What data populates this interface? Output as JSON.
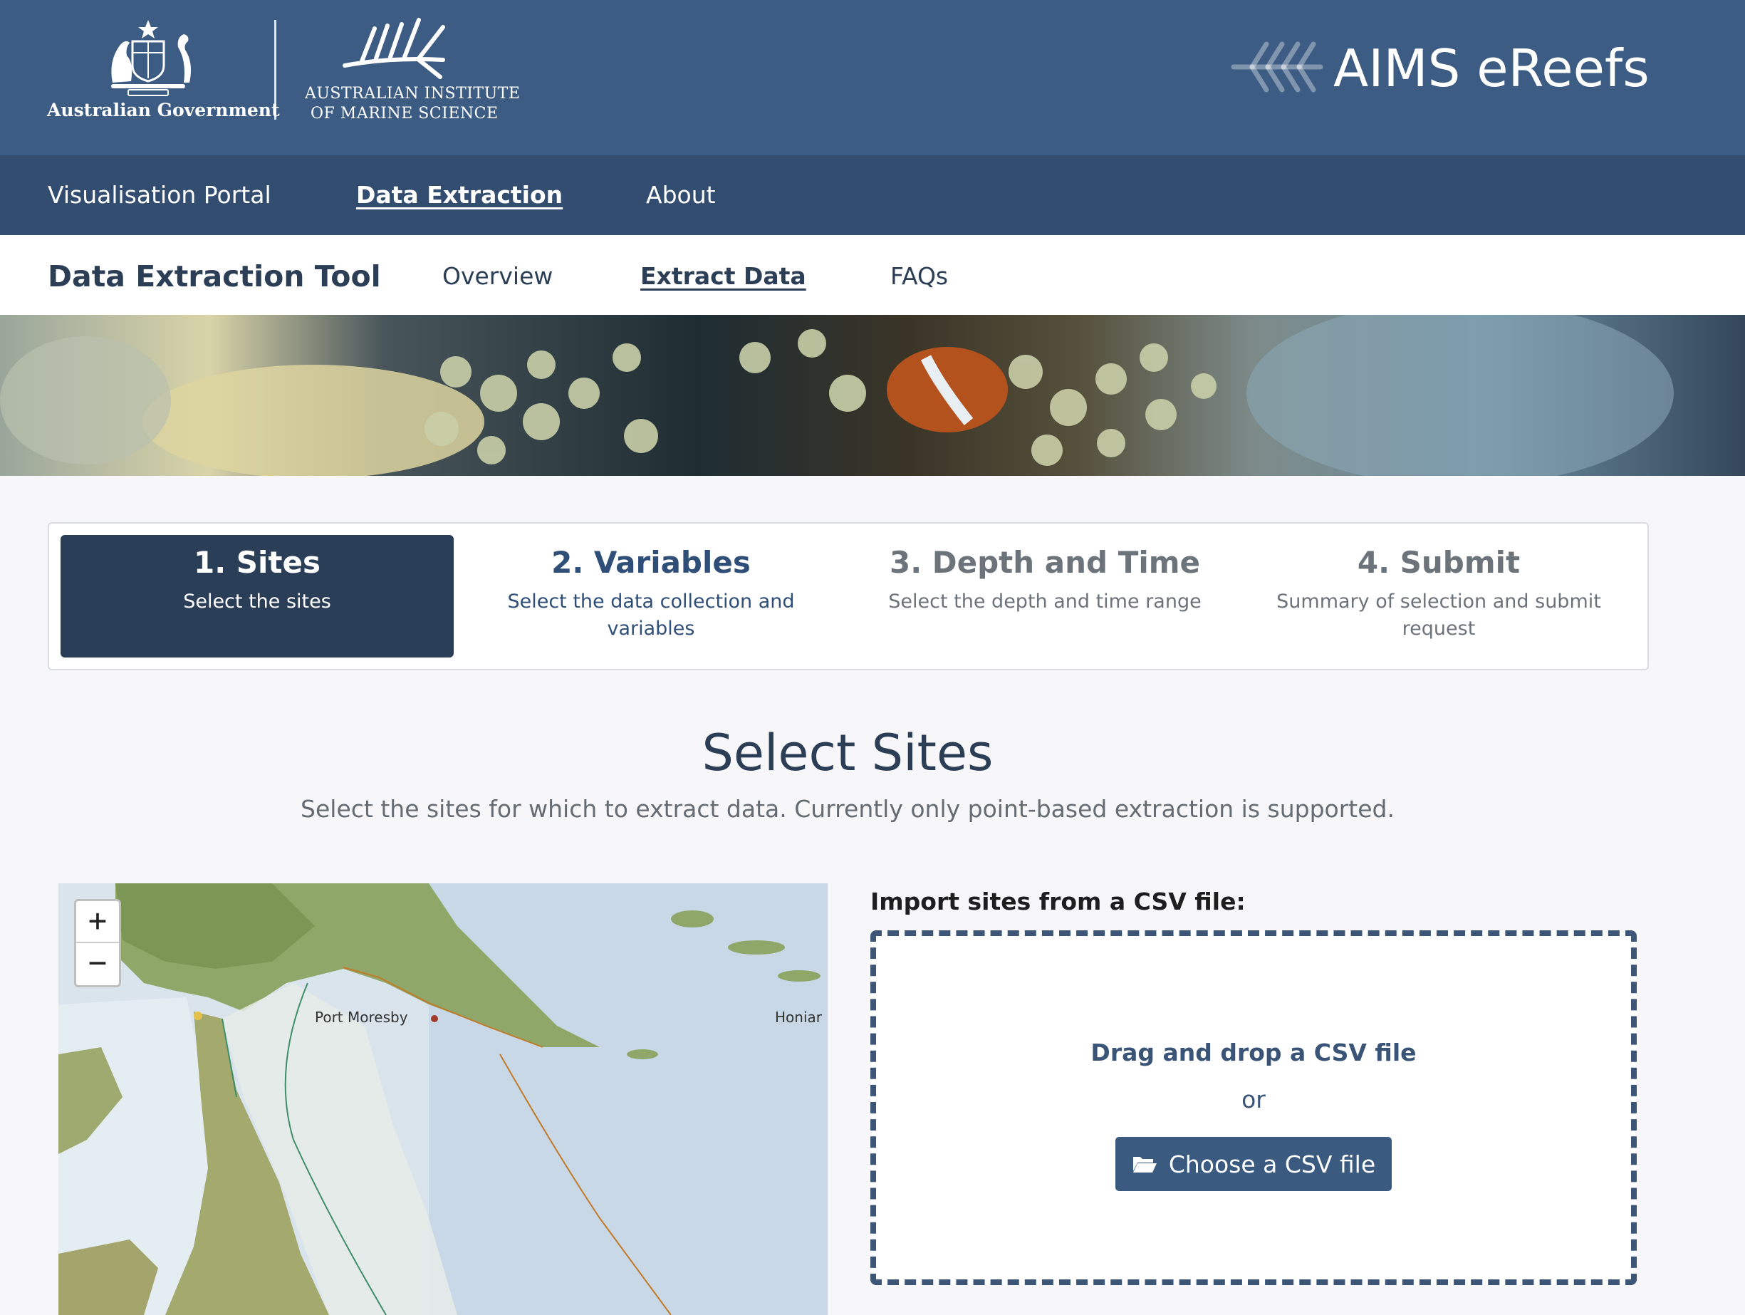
{
  "header": {
    "gov_logo_text": "Australian Government",
    "aims_logo_text_line1": "AUSTRALIAN INSTITUTE",
    "aims_logo_text_line2": "OF MARINE SCIENCE",
    "brand_title": "AIMS eReefs"
  },
  "main_nav": {
    "items": [
      {
        "label": "Visualisation Portal"
      },
      {
        "label": "Data Extraction",
        "active": true
      },
      {
        "label": "About"
      }
    ]
  },
  "sub_nav": {
    "title": "Data Extraction Tool",
    "items": [
      {
        "label": "Overview"
      },
      {
        "label": "Extract Data",
        "active": true
      },
      {
        "label": "FAQs"
      }
    ]
  },
  "steps": [
    {
      "title": "1. Sites",
      "desc": "Select the sites",
      "state": "active"
    },
    {
      "title": "2. Variables",
      "desc": "Select the data collection and variables",
      "state": "next"
    },
    {
      "title": "3. Depth and Time",
      "desc": "Select the depth and time range",
      "state": "disabled"
    },
    {
      "title": "4. Submit",
      "desc": "Summary of selection and submit request",
      "state": "disabled"
    }
  ],
  "section": {
    "title": "Select Sites",
    "subtitle": "Select the sites for which to extract data. Currently only point-based extraction is supported."
  },
  "map": {
    "zoom_in": "+",
    "zoom_out": "−",
    "labels": {
      "port_moresby": "Port Moresby",
      "honiara": "Honiar"
    }
  },
  "csv_import": {
    "heading": "Import sites from a CSV file:",
    "drop_title": "Drag and drop a CSV file",
    "or_text": "or",
    "button_label": "Choose a CSV file",
    "button_icon": "folder-open-icon"
  },
  "colors": {
    "header_bg": "#3d5c83",
    "nav_bg": "#324d6f",
    "accent_dark": "#2b3e58",
    "button_bg": "#3a5a80"
  }
}
